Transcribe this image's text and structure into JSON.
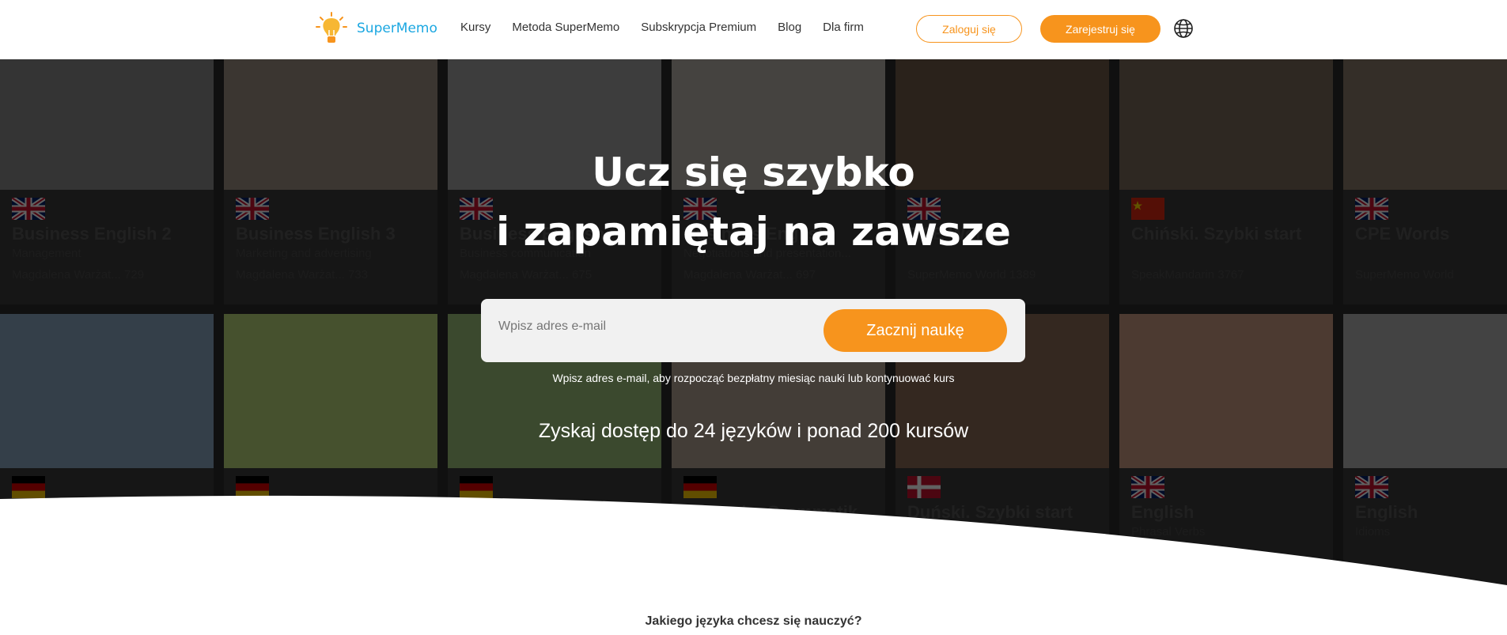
{
  "brand": {
    "name": "SuperMemo"
  },
  "nav": {
    "items": [
      "Kursy",
      "Metoda SuperMemo",
      "Subskrypcja Premium",
      "Blog",
      "Dla firm"
    ],
    "login": "Zaloguj się",
    "register": "Zarejestruj się"
  },
  "hero": {
    "title_line1": "Ucz się szybko",
    "title_line2": "i zapamiętaj na zawsze",
    "email_placeholder": "Wpisz adres e-mail",
    "start_button": "Zacznij naukę",
    "hint": "Wpisz adres e-mail, aby rozpocząć bezpłatny miesiąc nauki lub kontynuować kurs",
    "access": "Zyskaj dostęp do 24 języków i ponad 200 kursów"
  },
  "courses_row1": [
    {
      "title": "Business English 2",
      "subtitle": "Management",
      "author": "Magdalena Warżat...",
      "count": "729",
      "flag": "uk"
    },
    {
      "title": "Business English 3",
      "subtitle": "Marketing and advertising",
      "author": "Magdalena Warżat...",
      "count": "733",
      "flag": "uk"
    },
    {
      "title": "Business English",
      "subtitle": "Business communication",
      "author": "Magdalena Warżat...",
      "count": "675",
      "flag": "uk"
    },
    {
      "title": "Business English",
      "subtitle": "Negotiations and presentation...",
      "author": "Magdalena Warżat...",
      "count": "697",
      "flag": "uk"
    },
    {
      "title": "CAE Words",
      "subtitle": "",
      "author": "SuperMemo World",
      "count": "1389",
      "flag": "uk"
    },
    {
      "title": "Chiński. Szybki start",
      "subtitle": "",
      "author": "SpeakMandarin",
      "count": "3767",
      "flag": "cn"
    },
    {
      "title": "CPE Words",
      "subtitle": "",
      "author": "SuperMemo World",
      "count": "",
      "flag": "uk"
    }
  ],
  "courses_row2": [
    {
      "title": "",
      "subtitle": "",
      "flag": "de"
    },
    {
      "title": "",
      "subtitle": "",
      "flag": "de"
    },
    {
      "title": "",
      "subtitle": "",
      "flag": "de"
    },
    {
      "title": "Deutsche Grammatik",
      "subtitle": "",
      "flag": "de"
    },
    {
      "title": "Duński. Szybki start",
      "subtitle": "",
      "flag": "dk"
    },
    {
      "title": "English",
      "subtitle": "Phrasal Verbs",
      "flag": "uk"
    },
    {
      "title": "English",
      "subtitle": "Idioms",
      "flag": "uk"
    }
  ],
  "section": {
    "question": "Jakiego języka chcesz się nauczyć?"
  },
  "colors": {
    "accent": "#f7941d",
    "brand_blue": "#1ba7e1"
  },
  "icons": {
    "language": "globe-icon",
    "logo": "lightbulb-icon",
    "lessons": "document-icon"
  }
}
